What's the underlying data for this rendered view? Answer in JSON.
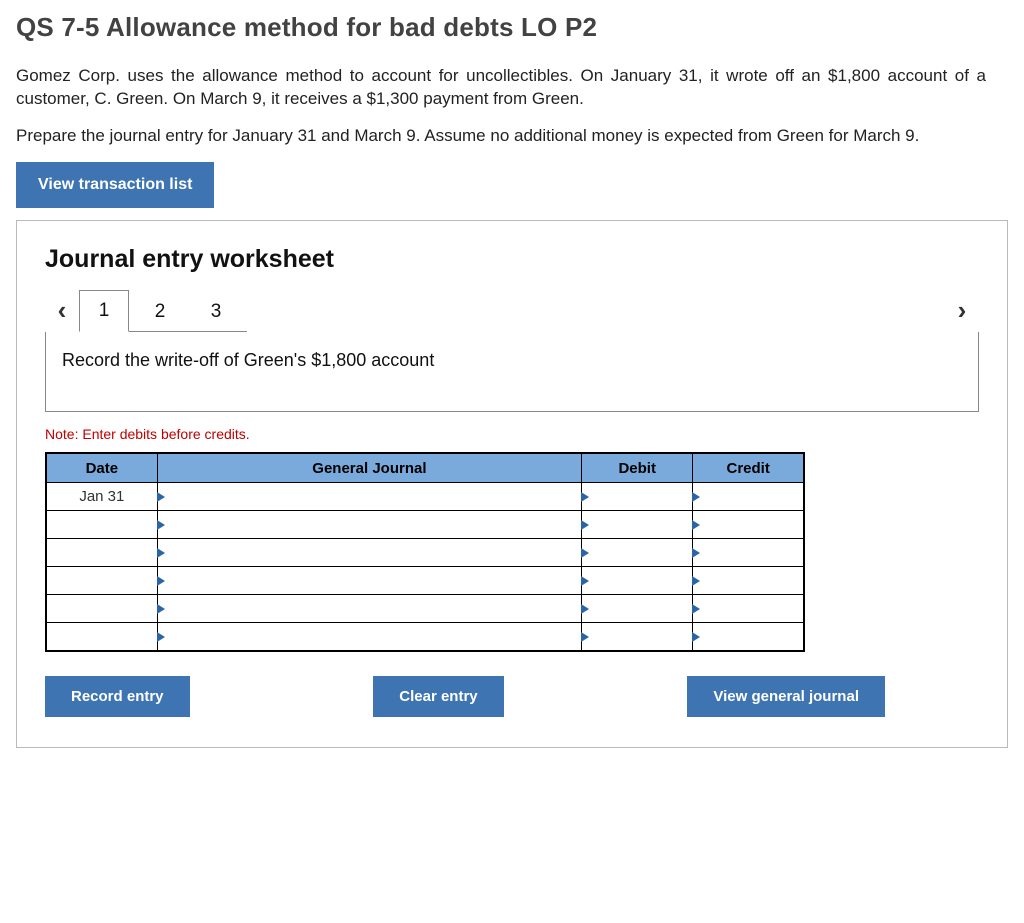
{
  "title": "QS 7-5 Allowance method for bad debts LO P2",
  "paragraph1": "Gomez Corp. uses the allowance method to account for uncollectibles. On January 31, it wrote off an $1,800 account of a customer, C. Green. On March 9, it receives a $1,300 payment from Green.",
  "paragraph2": "Prepare the journal entry for January 31 and March 9. Assume no additional money is expected from Green for March 9.",
  "buttons": {
    "view_transactions": "View transaction list",
    "record_entry": "Record entry",
    "clear_entry": "Clear entry",
    "view_general_journal": "View general journal"
  },
  "worksheet": {
    "heading": "Journal entry worksheet",
    "tabs": [
      "1",
      "2",
      "3"
    ],
    "active_tab_index": 0,
    "instruction": "Record the write-off of Green's $1,800 account",
    "note": "Note: Enter debits before credits.",
    "columns": {
      "date": "Date",
      "general_journal": "General Journal",
      "debit": "Debit",
      "credit": "Credit"
    },
    "rows": [
      {
        "date": "Jan 31",
        "general_journal": "",
        "debit": "",
        "credit": ""
      },
      {
        "date": "",
        "general_journal": "",
        "debit": "",
        "credit": ""
      },
      {
        "date": "",
        "general_journal": "",
        "debit": "",
        "credit": ""
      },
      {
        "date": "",
        "general_journal": "",
        "debit": "",
        "credit": ""
      },
      {
        "date": "",
        "general_journal": "",
        "debit": "",
        "credit": ""
      },
      {
        "date": "",
        "general_journal": "",
        "debit": "",
        "credit": ""
      }
    ]
  }
}
